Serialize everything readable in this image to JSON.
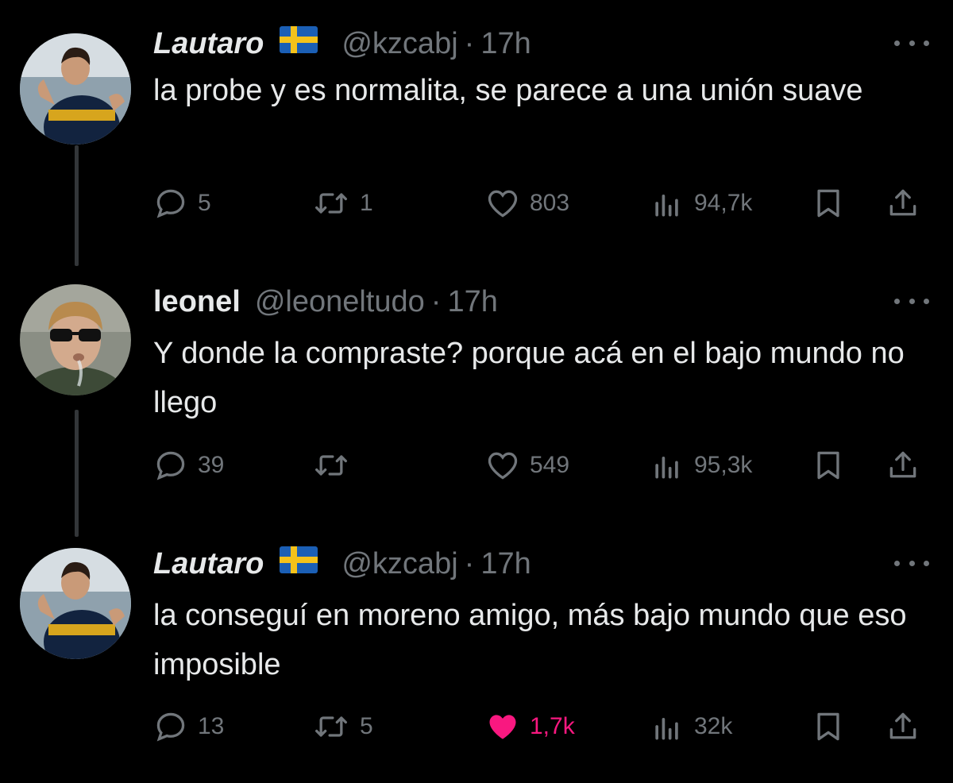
{
  "tweets": [
    {
      "name": "Lautaro",
      "flag": "sweden-flag",
      "handle": "@kzcabj",
      "time": "17h",
      "text": "la probe y es normalita, se parece a una unión suave",
      "replies": "5",
      "retweets": "1",
      "likes": "803",
      "views": "94,7k",
      "liked": false
    },
    {
      "name": "leonel",
      "handle": "@leoneltudo",
      "time": "17h",
      "text": "Y donde la compraste? porque acá en el bajo mundo no llego",
      "replies": "39",
      "retweets": "",
      "likes": "549",
      "views": "95,3k",
      "liked": false
    },
    {
      "name": "Lautaro",
      "flag": "sweden-flag",
      "handle": "@kzcabj",
      "time": "17h",
      "text": "la conseguí en moreno amigo, más bajo mundo que eso imposible",
      "replies": "13",
      "retweets": "5",
      "likes": "1,7k",
      "views": "32k",
      "liked": true
    }
  ],
  "separator": "·",
  "colors": {
    "background": "#000000",
    "text": "#e7e9ea",
    "secondary": "#71767b",
    "like_active": "#f91880",
    "thread_line": "#333639"
  },
  "icons": [
    "reply-icon",
    "retweet-icon",
    "like-icon",
    "views-icon",
    "bookmark-icon",
    "share-icon",
    "more-icon",
    "sweden-flag"
  ]
}
